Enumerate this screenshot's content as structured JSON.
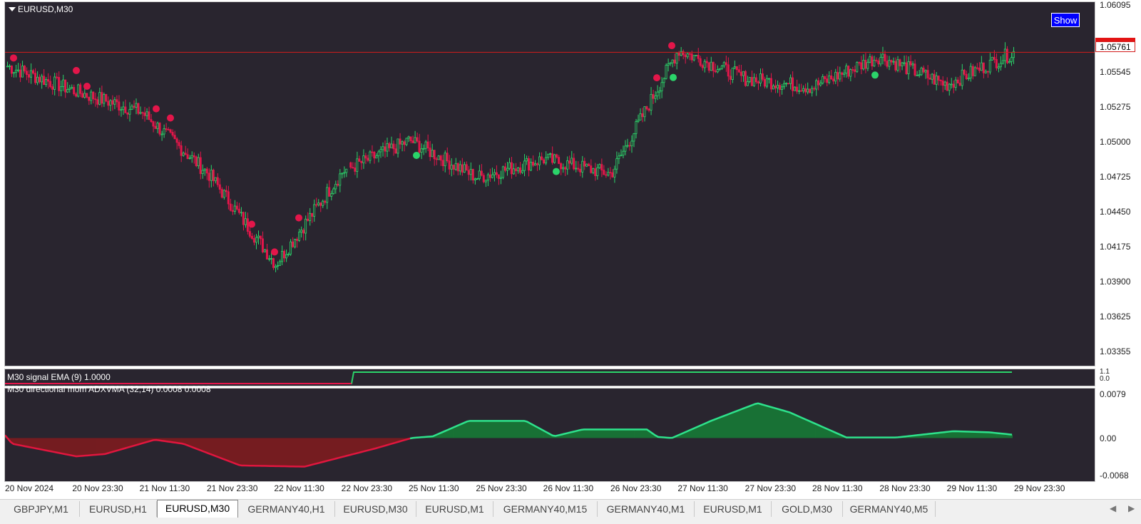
{
  "main": {
    "symbol_title": "EURUSD,M30",
    "show_button": "Show",
    "current_price": "1.05761",
    "price_labels": [
      "1.06095",
      "1.05545",
      "1.05275",
      "1.05000",
      "1.04725",
      "1.04450",
      "1.04175",
      "1.03900",
      "1.03625",
      "1.03355"
    ]
  },
  "signal_pane": {
    "title": "M30 signal EMA (9) 1.0000",
    "axis_labels": [
      "1.1",
      "0.0"
    ]
  },
  "momentum_pane": {
    "title": "M30 directional mom ADXVMA (32,14) 0.0008 0.0008",
    "axis_labels": [
      "0.0079",
      "0.00",
      "-0.0068"
    ]
  },
  "time_axis": [
    "20 Nov 2024",
    "20 Nov 23:30",
    "21 Nov 11:30",
    "21 Nov 23:30",
    "22 Nov 11:30",
    "22 Nov 23:30",
    "25 Nov 11:30",
    "25 Nov 23:30",
    "26 Nov 11:30",
    "26 Nov 23:30",
    "27 Nov 11:30",
    "27 Nov 23:30",
    "28 Nov 11:30",
    "28 Nov 23:30",
    "29 Nov 11:30",
    "29 Nov 23:30"
  ],
  "tabs": [
    {
      "label": "GBPJPY,M1",
      "active": false
    },
    {
      "label": "EURUSD,H1",
      "active": false
    },
    {
      "label": "EURUSD,M30",
      "active": true
    },
    {
      "label": "GERMANY40,H1",
      "active": false
    },
    {
      "label": "EURUSD,M30",
      "active": false
    },
    {
      "label": "EURUSD,M1",
      "active": false
    },
    {
      "label": "GERMANY40,M15",
      "active": false
    },
    {
      "label": "GERMANY40,M1",
      "active": false
    },
    {
      "label": "EURUSD,M1",
      "active": false
    },
    {
      "label": "GOLD,M30",
      "active": false
    },
    {
      "label": "GERMANY40,M5",
      "active": false
    }
  ],
  "colors": {
    "background": "#29252f",
    "bull": "#2bd46a",
    "bear": "#e3164a",
    "price_line": "#d31c1c",
    "mom_up": "#2ee28c",
    "mom_down": "#e0163e"
  },
  "chart_data": {
    "type": "candlestick",
    "title": "EURUSD,M30",
    "ylim": [
      1.033,
      1.0612
    ],
    "current_price": 1.05761,
    "close_path": [
      {
        "x": "20 Nov 2024",
        "y": 1.0565
      },
      {
        "x": "20 Nov 23:30",
        "y": 1.0545
      },
      {
        "x": "21 Nov 11:30",
        "y": 1.0528
      },
      {
        "x": "21 Nov 23:30",
        "y": 1.0478
      },
      {
        "x": "22 Nov 11:30",
        "y": 1.0405
      },
      {
        "x": "22 Nov 23:30",
        "y": 1.048
      },
      {
        "x": "25 Nov 11:30",
        "y": 1.0505
      },
      {
        "x": "25 Nov 23:30",
        "y": 1.0475
      },
      {
        "x": "26 Nov 11:30",
        "y": 1.049
      },
      {
        "x": "26 Nov 23:30",
        "y": 1.0478
      },
      {
        "x": "27 Nov 11:30",
        "y": 1.0578
      },
      {
        "x": "27 Nov 23:30",
        "y": 1.0555
      },
      {
        "x": "28 Nov 11:30",
        "y": 1.0548
      },
      {
        "x": "28 Nov 23:30",
        "y": 1.0573
      },
      {
        "x": "29 Nov 11:30",
        "y": 1.055
      },
      {
        "x": "29 Nov 23:30",
        "y": 1.0576
      }
    ],
    "momentum_ylim": [
      -0.0068,
      0.0079
    ]
  }
}
